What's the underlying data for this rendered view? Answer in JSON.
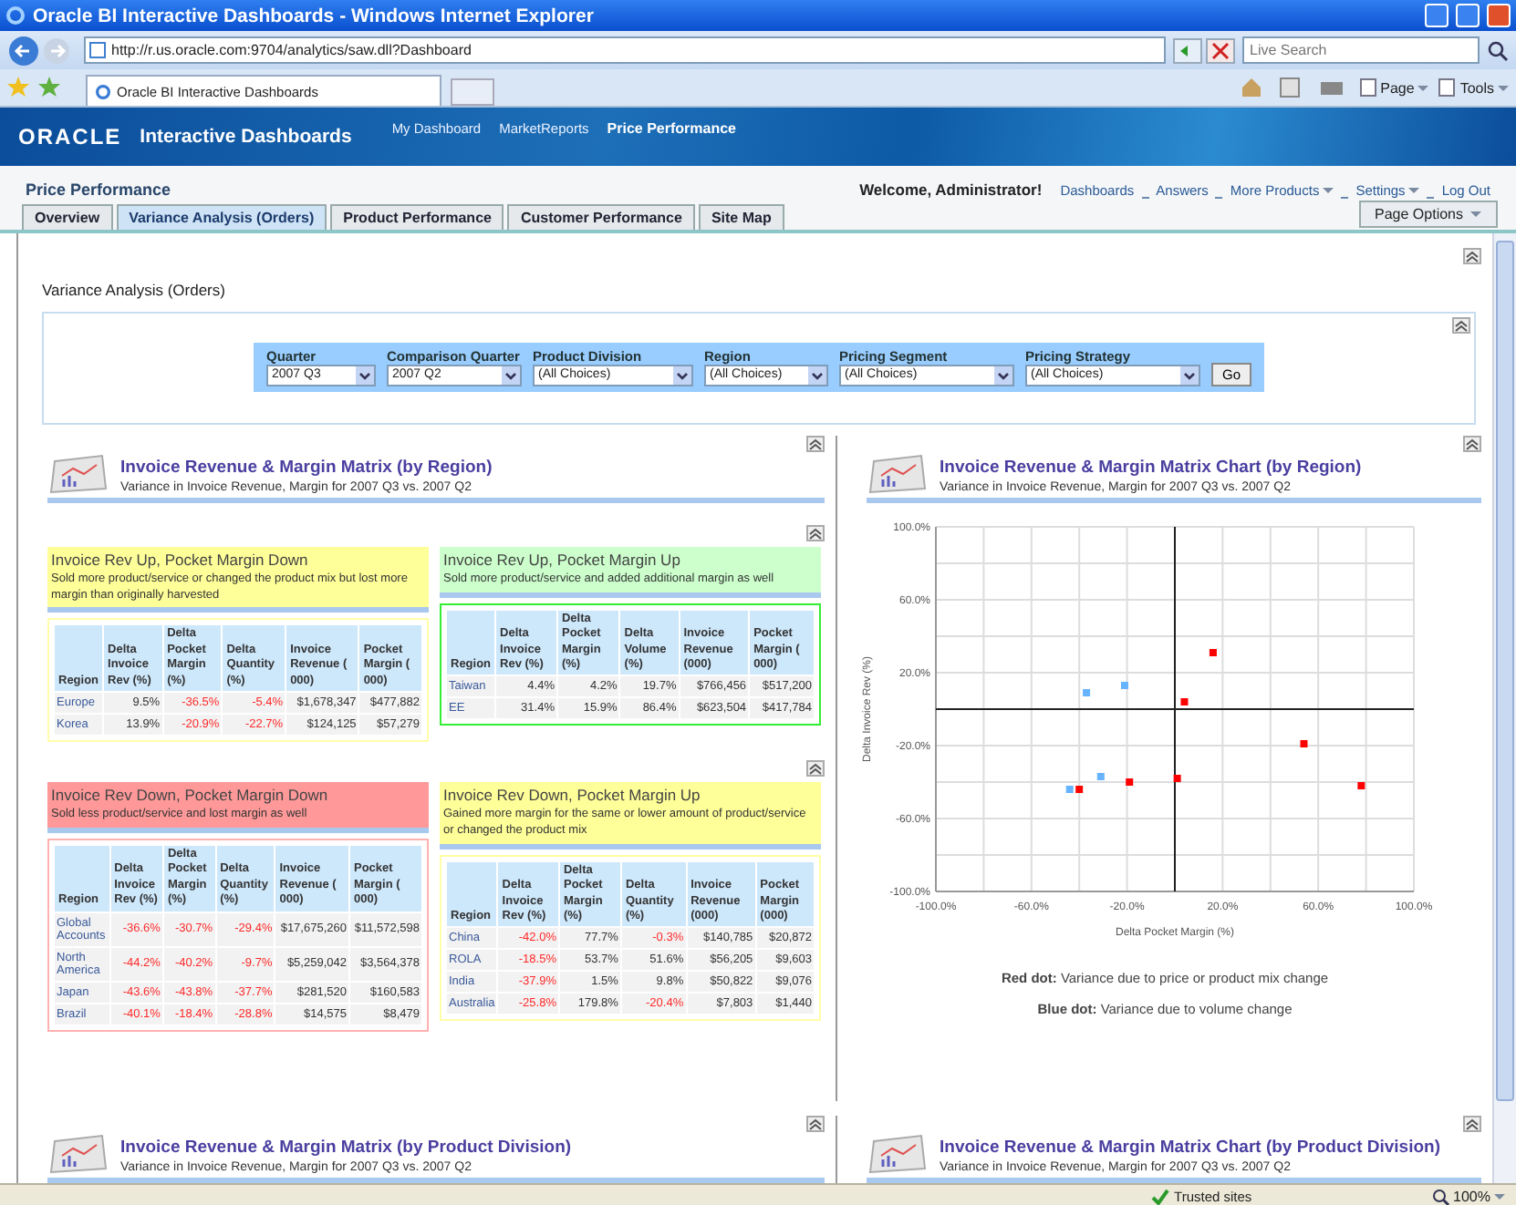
{
  "browser": {
    "title": "Oracle BI Interactive Dashboards - Windows Internet Explorer",
    "address": "http://r.us.oracle.com:9704/analytics/saw.dll?Dashboard",
    "search": {
      "placeholder": "Live Search"
    },
    "tab": "Oracle BI Interactive Dashboards",
    "commands": [
      "Page",
      "Tools"
    ]
  },
  "banner": {
    "logo": "ORACLE",
    "title": "Interactive Dashboards",
    "nav": [
      {
        "label": "My Dashboard",
        "selected": false
      },
      {
        "label": "MarketReports",
        "selected": false
      },
      {
        "label": "Price Performance",
        "selected": true
      }
    ]
  },
  "page": {
    "title": "Price Performance",
    "welcome": "Welcome, Administrator!",
    "links": [
      {
        "label": "Dashboards",
        "menu": false
      },
      {
        "label": "Answers",
        "menu": false
      },
      {
        "label": "More Products",
        "menu": true
      },
      {
        "label": "Settings",
        "menu": true
      },
      {
        "label": "Log Out",
        "menu": false
      }
    ]
  },
  "tabs": [
    {
      "label": "Overview",
      "selected": false
    },
    {
      "label": "Variance Analysis (Orders)",
      "selected": true
    },
    {
      "label": "Product Performance",
      "selected": false
    },
    {
      "label": "Customer Performance",
      "selected": false
    },
    {
      "label": "Site Map",
      "selected": false
    }
  ],
  "page_options": "Page Options",
  "section": {
    "title": "Variance Analysis (Orders)",
    "filters": [
      {
        "label": "Quarter",
        "value": "2007 Q3"
      },
      {
        "label": "Comparison Quarter",
        "value": "2007 Q2"
      },
      {
        "label": "Product Division",
        "value": "(All Choices)"
      },
      {
        "label": "Region",
        "value": "(All Choices)"
      },
      {
        "label": "Pricing Segment",
        "value": "(All Choices)"
      },
      {
        "label": "Pricing Strategy",
        "value": "(All Choices)"
      }
    ],
    "go": "Go"
  },
  "matrix": {
    "title": "Invoice Revenue & Margin Matrix (by Region)",
    "subtitle": "Variance in Invoice Revenue, Margin for 2007 Q3 vs. 2007 Q2",
    "quadrants": [
      {
        "kind": "warn",
        "title": "Invoice Rev Up, Pocket Margin Down",
        "description": "Sold more product/service or changed the product mix but lost more margin than originally harvested",
        "columns": [
          "Region",
          "Delta Invoice Rev (%)",
          "Delta Pocket Margin (%)",
          "Delta Quantity (%)",
          "Invoice Revenue ( 000)",
          "Pocket Margin ( 000)"
        ],
        "rows": [
          {
            "cells": [
              "Europe",
              "9.5%",
              "-36.5%",
              "-5.4%",
              "$1,678,347",
              "$477,882"
            ],
            "negative": [
              false,
              false,
              true,
              true,
              false,
              false
            ]
          },
          {
            "cells": [
              "Korea",
              "13.9%",
              "-20.9%",
              "-22.7%",
              "$124,125",
              "$57,279"
            ],
            "negative": [
              false,
              false,
              true,
              true,
              false,
              false
            ]
          }
        ]
      },
      {
        "kind": "good",
        "title": "Invoice Rev Up, Pocket Margin Up",
        "description": "Sold more product/service and added additional margin as well",
        "columns": [
          "Region",
          "Delta Invoice Rev (%)",
          "Delta Pocket Margin (%)",
          "Delta Volume (%)",
          "Invoice Revenue (000)",
          "Pocket Margin ( 000)"
        ],
        "rows": [
          {
            "cells": [
              "Taiwan",
              "4.4%",
              "4.2%",
              "19.7%",
              "$766,456",
              "$517,200"
            ],
            "negative": [
              false,
              false,
              false,
              false,
              false,
              false
            ]
          },
          {
            "cells": [
              "EE",
              "31.4%",
              "15.9%",
              "86.4%",
              "$623,504",
              "$417,784"
            ],
            "negative": [
              false,
              false,
              false,
              false,
              false,
              false
            ]
          }
        ]
      },
      {
        "kind": "bad",
        "title": "Invoice Rev Down, Pocket Margin Down",
        "description": "Sold less product/service and lost margin as well",
        "columns": [
          "Region",
          "Delta Invoice Rev (%)",
          "Delta Pocket Margin (%)",
          "Delta Quantity (%)",
          "Invoice Revenue ( 000)",
          "Pocket Margin ( 000)"
        ],
        "rows": [
          {
            "cells": [
              "Global Accounts",
              "-36.6%",
              "-30.7%",
              "-29.4%",
              "$17,675,260",
              "$11,572,598"
            ],
            "negative": [
              false,
              true,
              true,
              true,
              false,
              false
            ]
          },
          {
            "cells": [
              "North America",
              "-44.2%",
              "-40.2%",
              "-9.7%",
              "$5,259,042",
              "$3,564,378"
            ],
            "negative": [
              false,
              true,
              true,
              true,
              false,
              false
            ]
          },
          {
            "cells": [
              "Japan",
              "-43.6%",
              "-43.8%",
              "-37.7%",
              "$281,520",
              "$160,583"
            ],
            "negative": [
              false,
              true,
              true,
              true,
              false,
              false
            ]
          },
          {
            "cells": [
              "Brazil",
              "-40.1%",
              "-18.4%",
              "-28.8%",
              "$14,575",
              "$8,479"
            ],
            "negative": [
              false,
              true,
              true,
              true,
              false,
              false
            ]
          }
        ]
      },
      {
        "kind": "warn",
        "title": "Invoice Rev Down, Pocket Margin Up",
        "description": "Gained more margin for the same or lower amount of product/service or changed the product mix",
        "columns": [
          "Region",
          "Delta Invoice Rev (%)",
          "Delta Pocket Margin (%)",
          "Delta Quantity (%)",
          "Invoice Revenue (000)",
          "Pocket Margin (000)"
        ],
        "rows": [
          {
            "cells": [
              "China",
              "-42.0%",
              "77.7%",
              "-0.3%",
              "$140,785",
              "$20,872"
            ],
            "negative": [
              false,
              true,
              false,
              true,
              false,
              false
            ]
          },
          {
            "cells": [
              "ROLA",
              "-18.5%",
              "53.7%",
              "51.6%",
              "$56,205",
              "$9,603"
            ],
            "negative": [
              false,
              true,
              false,
              false,
              false,
              false
            ]
          },
          {
            "cells": [
              "India",
              "-37.9%",
              "1.5%",
              "9.8%",
              "$50,822",
              "$9,076"
            ],
            "negative": [
              false,
              true,
              false,
              false,
              false,
              false
            ]
          },
          {
            "cells": [
              "Australia",
              "-25.8%",
              "179.8%",
              "-20.4%",
              "$7,803",
              "$1,440"
            ],
            "negative": [
              false,
              true,
              false,
              true,
              false,
              false
            ]
          }
        ]
      }
    ]
  },
  "matrix_chart": {
    "title": "Invoice Revenue & Margin Matrix Chart (by Region)",
    "subtitle": "Variance in Invoice Revenue, Margin for 2007 Q3 vs. 2007 Q2",
    "chart_data": {
      "type": "scatter",
      "grid": true,
      "xlabel": "Delta Pocket Margin (%)",
      "ylabel": "Delta Invoice Rev (%)",
      "xlim": [
        -100,
        100
      ],
      "ylim": [
        -100,
        100
      ],
      "xticks": [
        {
          "value": -100,
          "label": "-100.0%"
        },
        {
          "value": -60,
          "label": "-60.0%"
        },
        {
          "value": -20,
          "label": "-20.0%"
        },
        {
          "value": 20,
          "label": "20.0%"
        },
        {
          "value": 60,
          "label": "60.0%"
        },
        {
          "value": 100,
          "label": "100.0%"
        }
      ],
      "yticks": [
        {
          "value": 100,
          "label": "100.0%"
        },
        {
          "value": 60,
          "label": "60.0%"
        },
        {
          "value": 20,
          "label": "20.0%"
        },
        {
          "value": -20,
          "label": "-20.0%"
        },
        {
          "value": -60,
          "label": "-60.0%"
        },
        {
          "value": -100,
          "label": "-100.0%"
        }
      ],
      "series": [
        {
          "color": "#ff0000",
          "x": [
            16,
            4,
            54,
            1,
            -19,
            -40,
            78
          ],
          "values": [
            31,
            4,
            -19,
            -38,
            -40,
            -44,
            -42
          ]
        },
        {
          "color": "#66b3ff",
          "x": [
            -37,
            -21,
            -31,
            -44
          ],
          "values": [
            9,
            13,
            -37,
            -44
          ]
        }
      ]
    },
    "legend": [
      "**Red dot:** Variance due to price or product mix change",
      "**Blue dot:** Variance due to volume change"
    ]
  },
  "bottom_reports": [
    {
      "title": "Invoice Revenue & Margin Matrix (by Product Division)",
      "subtitle": "Variance in Invoice Revenue, Margin for 2007 Q3 vs. 2007 Q2"
    },
    {
      "title": "Invoice Revenue & Margin Matrix Chart (by Product Division)",
      "subtitle": "Variance in Invoice Revenue, Margin for 2007 Q3 vs. 2007 Q2"
    }
  ],
  "status_bar": {
    "zone": "Trusted sites",
    "zoom": "100%"
  }
}
